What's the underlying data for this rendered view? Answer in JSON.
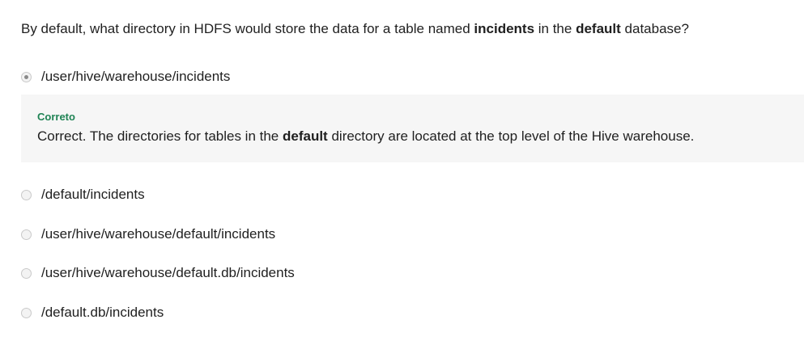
{
  "question": {
    "part1": "By default, what directory in HDFS would store the data for a table named ",
    "bold1": "incidents",
    "part2": " in the ",
    "bold2": "default",
    "part3": " database?"
  },
  "options": [
    {
      "label": "/user/hive/warehouse/incidents",
      "selected": true
    },
    {
      "label": "/default/incidents",
      "selected": false
    },
    {
      "label": "/user/hive/warehouse/default/incidents",
      "selected": false
    },
    {
      "label": "/user/hive/warehouse/default.db/incidents",
      "selected": false
    },
    {
      "label": "/default.db/incidents",
      "selected": false
    }
  ],
  "feedback": {
    "title": "Correto",
    "part1": "Correct. The directories for tables in the ",
    "bold": "default",
    "part2": " directory are located at the top level of the Hive warehouse."
  },
  "colors": {
    "feedback_title": "#1f8354",
    "feedback_bg": "#f6f6f6"
  }
}
